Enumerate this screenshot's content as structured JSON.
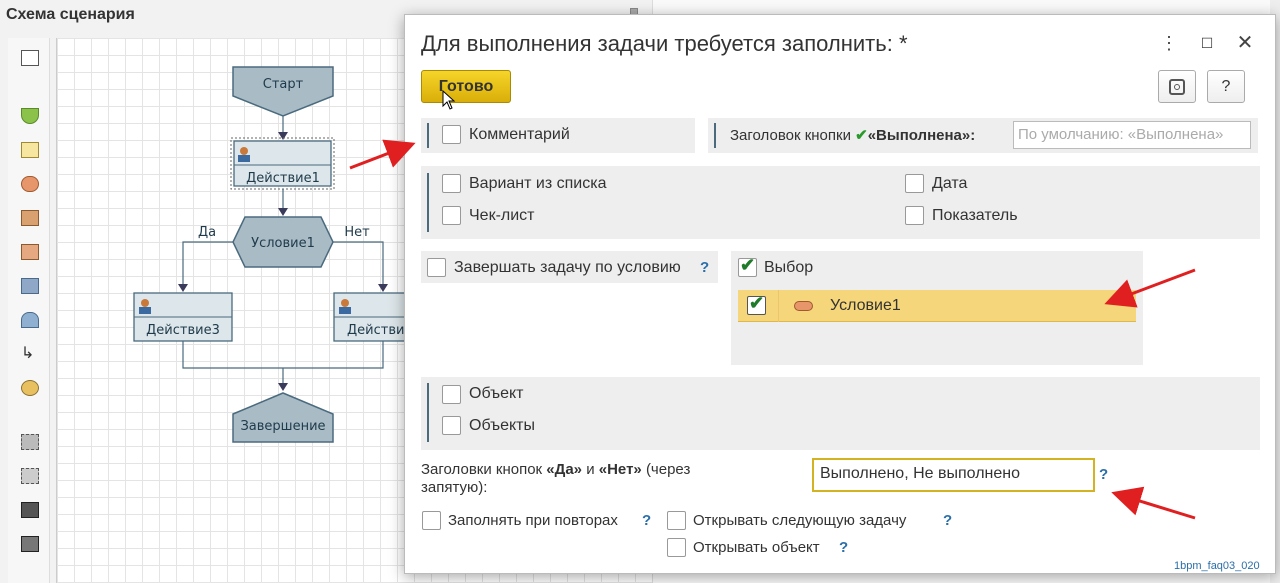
{
  "background": {
    "panel_title": "Схема сценария",
    "nodes": {
      "start": "Старт",
      "action1": "Действие1",
      "condition": "Условие1",
      "yes": "Да",
      "no": "Нет",
      "action3": "Действие3",
      "action_right": "Действие",
      "end": "Завершение"
    }
  },
  "dialog": {
    "title": "Для выполнения задачи требуется заполнить: *",
    "done_button": "Готово",
    "help_button": "?",
    "comment_label": "Комментарий",
    "button_caption_label_prefix": "Заголовок кнопки",
    "button_caption_label_bold": "«Выполнена»:",
    "button_caption_placeholder": "По умолчанию: «Выполнена»",
    "variant_label": "Вариант из списка",
    "date_label": "Дата",
    "checklist_label": "Чек-лист",
    "indicator_label": "Показатель",
    "finish_by_condition_label": "Завершать задачу по условию",
    "choice_label": "Выбор",
    "choice_items": [
      {
        "label": "Условие1",
        "checked": true
      }
    ],
    "object_label": "Объект",
    "objects_label": "Объекты",
    "yes_no_captions_label_1": "Заголовки кнопок",
    "yes_bold": "«Да»",
    "and_text": "и",
    "no_bold": "«Нет»",
    "yes_no_captions_label_2": "(через",
    "yes_no_captions_label_3": "запятую):",
    "yes_no_value": "Выполнено, Не выполнено",
    "fill_on_repeat_label": "Заполнять при повторах",
    "open_next_task_label": "Открывать следующую задачу",
    "open_object_label": "Открывать объект",
    "help_q": "?"
  },
  "watermark": "1bpm_faq03_020",
  "colors": {
    "accent_yellow": "#d9ae08",
    "highlight_row": "#f5d67a",
    "node_fill": "#a9bcc6",
    "arrow_red": "#e02020"
  }
}
